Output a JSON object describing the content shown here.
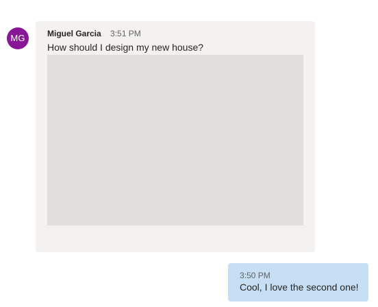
{
  "incoming_message": {
    "avatar_initials": "MG",
    "avatar_color": "#881798",
    "sender": "Miguel Garcia",
    "time": "3:51 PM",
    "text": "How should I design my new house?",
    "bubble_color": "#f3f2f1",
    "image_placeholder_color": "#e0dfde"
  },
  "outgoing_message": {
    "time": "3:50 PM",
    "text": "Cool, I love the second one!",
    "bubble_color": "#c7dff4"
  }
}
